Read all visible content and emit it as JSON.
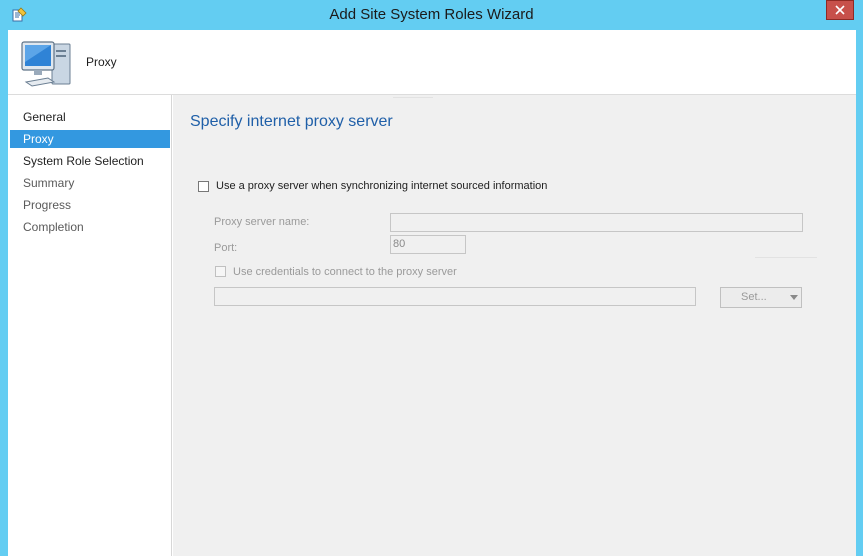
{
  "window": {
    "title": "Add Site System Roles Wizard"
  },
  "header": {
    "title": "Proxy",
    "icon": "computer-icon"
  },
  "nav": {
    "items": [
      {
        "label": "General",
        "state": "done"
      },
      {
        "label": "Proxy",
        "state": "active"
      },
      {
        "label": "System Role Selection",
        "state": "done"
      },
      {
        "label": "Summary",
        "state": "pending"
      },
      {
        "label": "Progress",
        "state": "pending"
      },
      {
        "label": "Completion",
        "state": "pending"
      }
    ]
  },
  "page": {
    "heading": "Specify internet proxy server",
    "use_proxy": {
      "label": "Use a proxy server when synchronizing internet sourced information",
      "checked": false
    },
    "proxy_name": {
      "label": "Proxy server name:",
      "value": ""
    },
    "port": {
      "label": "Port:",
      "value": "80"
    },
    "use_credentials": {
      "label": "Use credentials to connect to the proxy server",
      "checked": false
    },
    "credentials_value": "",
    "set_button": "Set..."
  },
  "colors": {
    "titlebar": "#63cdf2",
    "accent": "#3398e0",
    "heading": "#1f5fa8",
    "close": "#c7504a"
  }
}
